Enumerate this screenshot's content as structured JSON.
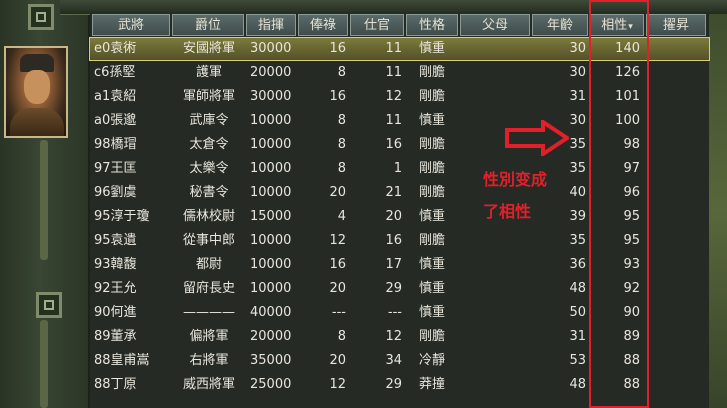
{
  "columns": [
    "武將",
    "爵位",
    "指揮",
    "俸祿",
    "仕官",
    "性格",
    "父母",
    "年齡",
    "相性",
    "擢昇"
  ],
  "sort_indicator": "▾",
  "rows": [
    {
      "name": "e0袁術",
      "rank": "安國將軍",
      "command": "30000",
      "salary": "16",
      "service": "11",
      "personality": "慎重",
      "age": "30",
      "affinity": "140"
    },
    {
      "name": "c6孫堅",
      "rank": "護軍",
      "command": "20000",
      "salary": "8",
      "service": "11",
      "personality": "剛膽",
      "age": "30",
      "affinity": "126"
    },
    {
      "name": "a1袁紹",
      "rank": "軍師將軍",
      "command": "30000",
      "salary": "16",
      "service": "12",
      "personality": "剛膽",
      "age": "31",
      "affinity": "101"
    },
    {
      "name": "a0張邈",
      "rank": "武庫令",
      "command": "10000",
      "salary": "8",
      "service": "11",
      "personality": "慎重",
      "age": "30",
      "affinity": "100"
    },
    {
      "name": "98橋瑁",
      "rank": "太倉令",
      "command": "10000",
      "salary": "8",
      "service": "16",
      "personality": "剛膽",
      "age": "35",
      "affinity": "98"
    },
    {
      "name": "97王匡",
      "rank": "太樂令",
      "command": "10000",
      "salary": "8",
      "service": "1",
      "personality": "剛膽",
      "age": "35",
      "affinity": "97"
    },
    {
      "name": "96劉虞",
      "rank": "秘書令",
      "command": "10000",
      "salary": "20",
      "service": "21",
      "personality": "剛膽",
      "age": "40",
      "affinity": "96"
    },
    {
      "name": "95淳于瓊",
      "rank": "儒林校尉",
      "command": "15000",
      "salary": "4",
      "service": "20",
      "personality": "慎重",
      "age": "39",
      "affinity": "95"
    },
    {
      "name": "95袁遺",
      "rank": "從事中郎",
      "command": "10000",
      "salary": "12",
      "service": "16",
      "personality": "剛膽",
      "age": "35",
      "affinity": "95"
    },
    {
      "name": "93韓馥",
      "rank": "都尉",
      "command": "10000",
      "salary": "16",
      "service": "17",
      "personality": "慎重",
      "age": "36",
      "affinity": "93"
    },
    {
      "name": "92王允",
      "rank": "留府長史",
      "command": "10000",
      "salary": "20",
      "service": "29",
      "personality": "慎重",
      "age": "48",
      "affinity": "92"
    },
    {
      "name": "90何進",
      "rank": "————",
      "command": "40000",
      "salary": "---",
      "service": "---",
      "personality": "慎重",
      "age": "50",
      "affinity": "90"
    },
    {
      "name": "89董承",
      "rank": "偏將軍",
      "command": "20000",
      "salary": "8",
      "service": "12",
      "personality": "剛膽",
      "age": "31",
      "affinity": "89"
    },
    {
      "name": "88皇甫嵩",
      "rank": "右將軍",
      "command": "35000",
      "salary": "20",
      "service": "34",
      "personality": "冷靜",
      "age": "53",
      "affinity": "88"
    },
    {
      "name": "88丁原",
      "rank": "威西將軍",
      "command": "25000",
      "salary": "12",
      "service": "29",
      "personality": "莽撞",
      "age": "48",
      "affinity": "88"
    }
  ],
  "annotation": {
    "line1": "性別变成",
    "line2": "了相性"
  },
  "colors": {
    "highlight": "#e2202a",
    "selected_row": "#7c7a3a"
  }
}
